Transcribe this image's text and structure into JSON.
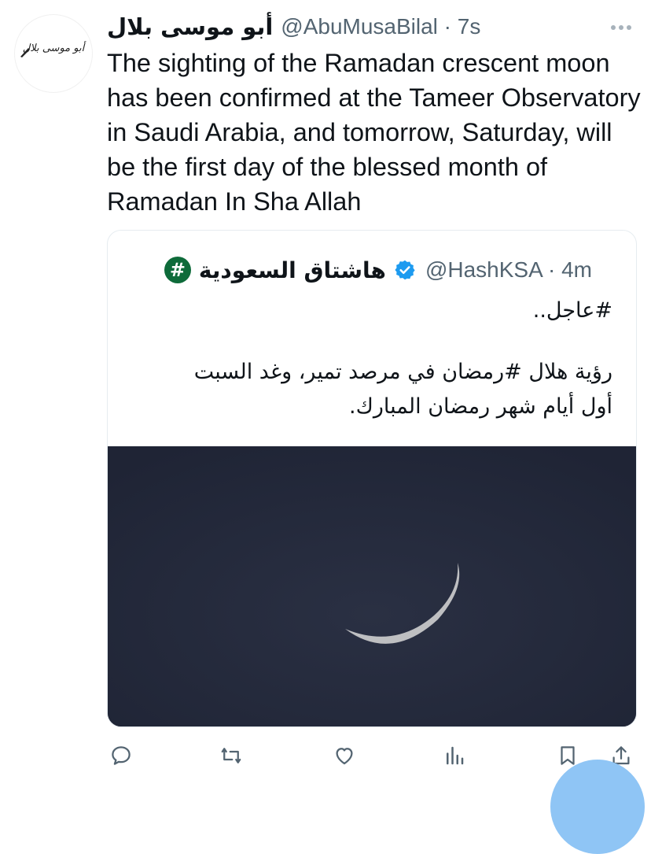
{
  "tweet": {
    "display_name": "أبو موسى بلال",
    "handle_line": "@AbuMusaBilal · 7s",
    "avatar_text": "أبو موسى بلال",
    "text": "The sighting of the Ramadan crescent moon has been confirmed at the Tameer Observatory in Saudi Arabia, and tomorrow, Saturday, will be the first day of the blessed month of Ramadan In Sha Allah"
  },
  "quote": {
    "badge": "#",
    "name": "هاشتاق السعودية",
    "handle_line": "@HashKSA · 4m",
    "line1": "#عاجل..",
    "line2": "رؤية هلال #رمضان في مرصد تمير، وغد السبت",
    "line3": "أول أيام شهر رمضان المبارك."
  },
  "actions": [
    "reply-icon",
    "retweet-icon",
    "like-icon",
    "views-icon",
    "bookmark-icon",
    "share-icon"
  ],
  "colors": {
    "text": "#0f1419",
    "muted": "#536471",
    "badge": "#0e6b3a",
    "verified": "#1d9bf0",
    "media_bg": "#232838"
  }
}
